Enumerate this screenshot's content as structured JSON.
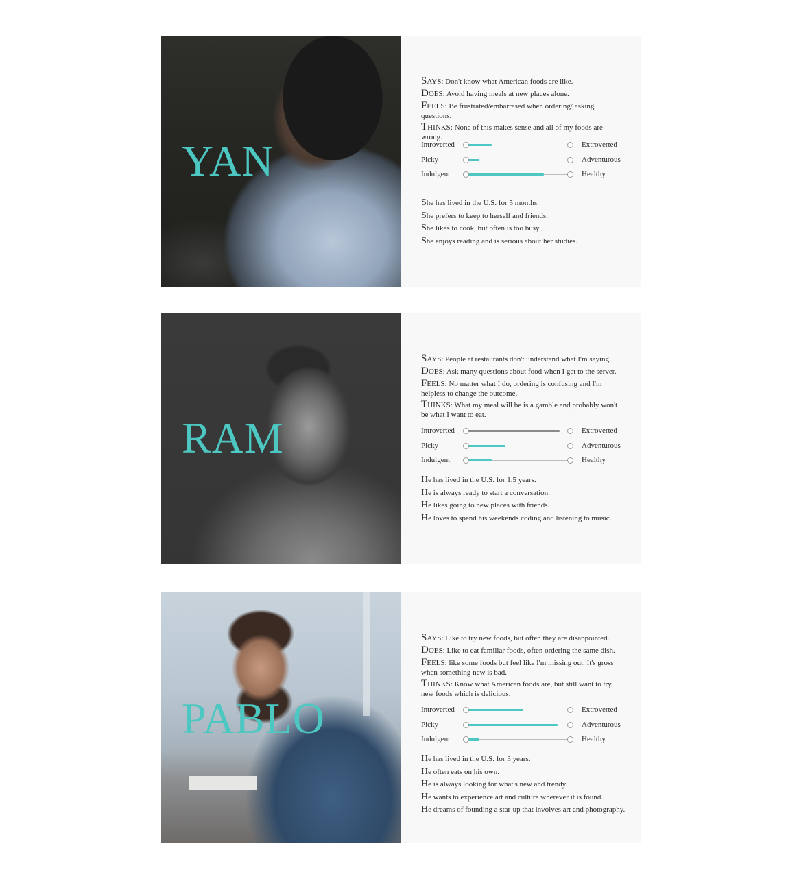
{
  "personas": [
    {
      "name": "YAN",
      "sdft": [
        {
          "cap": "S",
          "rest": "AYS:",
          "text": " Don't know what American foods are like."
        },
        {
          "cap": "D",
          "rest": "OES:",
          "text": " Avoid having meals at new places alone."
        },
        {
          "cap": "F",
          "rest": "EELS:",
          "text": " Be frustrated/embarrased when ordering/ asking questions."
        },
        {
          "cap": "T",
          "rest": "HINKS:",
          "text": " None of this makes sense and all of my foods are wrong."
        }
      ],
      "sliders": [
        {
          "left": "Introverted",
          "right": "Extroverted",
          "value": 0.25,
          "color": "#4dc7c1"
        },
        {
          "left": "Picky",
          "right": "Adventurous",
          "value": 0.13,
          "color": "#4dc7c1"
        },
        {
          "left": "Indulgent",
          "right": "Healthy",
          "value": 0.75,
          "color": "#4dc7c1"
        }
      ],
      "facts": [
        {
          "cap": "S",
          "text": "he has lived in the U.S. for 5 months."
        },
        {
          "cap": "S",
          "text": "he prefers to keep to herself and friends."
        },
        {
          "cap": "S",
          "text": "he likes to cook, but often is too busy."
        },
        {
          "cap": "S",
          "text": "he enjoys reading and is serious about her studies."
        }
      ]
    },
    {
      "name": "RAM",
      "sdft": [
        {
          "cap": "S",
          "rest": "AYS:",
          "text": " People at restaurants don't understand what I'm saying."
        },
        {
          "cap": "D",
          "rest": "OES:",
          "text": " Ask many questions about food when I get to the server."
        },
        {
          "cap": "F",
          "rest": "EELS:",
          "text": " No matter what I do, ordering is confusing and I'm helpless to change the outcome."
        },
        {
          "cap": "T",
          "rest": "HINKS:",
          "text": " What my meal will be is a gamble and probably won't be what I want to eat."
        }
      ],
      "sliders": [
        {
          "left": "Introverted",
          "right": "Extroverted",
          "value": 0.9,
          "color": "#8a8a8a"
        },
        {
          "left": "Picky",
          "right": "Adventurous",
          "value": 0.38,
          "color": "#4dc7c1"
        },
        {
          "left": "Indulgent",
          "right": "Healthy",
          "value": 0.25,
          "color": "#4dc7c1"
        }
      ],
      "facts": [
        {
          "cap": "H",
          "text": "e has lived in the U.S. for 1.5 years."
        },
        {
          "cap": "H",
          "text": "e is always ready to start a conversation."
        },
        {
          "cap": "H",
          "text": "e likes going to new places with friends."
        },
        {
          "cap": "H",
          "text": "e loves to spend his weekends coding and listening to music."
        }
      ]
    },
    {
      "name": "PABLO",
      "sdft": [
        {
          "cap": "S",
          "rest": "AYS:",
          "text": " Like to try new foods, but often they are disappointed."
        },
        {
          "cap": "D",
          "rest": "OES:",
          "text": " Like to eat familiar foods, often ordering the same dish."
        },
        {
          "cap": "F",
          "rest": "EELS:",
          "text": " like some foods but feel like I'm missing out. It's gross when something new is bad."
        },
        {
          "cap": "T",
          "rest": "HINKS:",
          "text": " Know what American foods are, but still want to try new foods which is delicious."
        }
      ],
      "sliders": [
        {
          "left": "Introverted",
          "right": "Extroverted",
          "value": 0.55,
          "color": "#4dc7c1"
        },
        {
          "left": "Picky",
          "right": "Adventurous",
          "value": 0.88,
          "color": "#4dc7c1"
        },
        {
          "left": "Indulgent",
          "right": "Healthy",
          "value": 0.13,
          "color": "#4dc7c1"
        }
      ],
      "facts": [
        {
          "cap": "H",
          "text": "e has lived in the U.S. for 3 years."
        },
        {
          "cap": "H",
          "text": "e often eats on his own."
        },
        {
          "cap": "H",
          "text": "e is always looking for what's new and trendy."
        },
        {
          "cap": "H",
          "text": "e wants to experience art and culture wherever it is found."
        },
        {
          "cap": "H",
          "text": "e dreams of founding a star-up that involves art and photography."
        }
      ]
    }
  ],
  "colors": {
    "accent": "#4dc7c1",
    "panel": "#f8f8f8"
  }
}
